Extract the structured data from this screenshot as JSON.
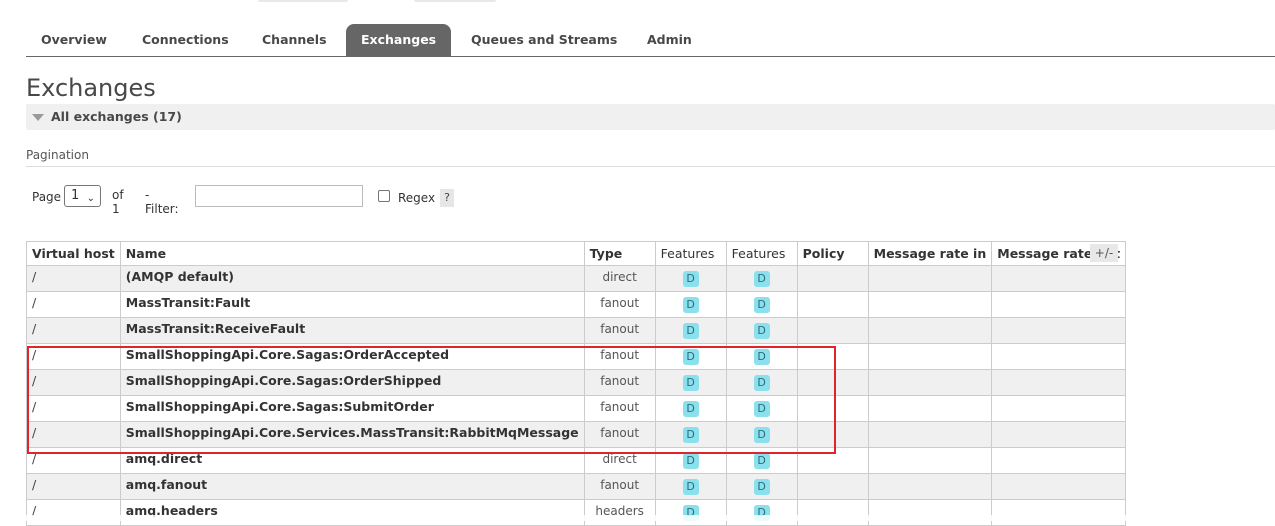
{
  "nav": {
    "tabs": [
      {
        "label": "Overview"
      },
      {
        "label": "Connections"
      },
      {
        "label": "Channels"
      },
      {
        "label": "Exchanges",
        "active": true
      },
      {
        "label": "Queues and Streams"
      },
      {
        "label": "Admin"
      }
    ]
  },
  "page": {
    "title": "Exchanges",
    "section_header": "All exchanges (17)"
  },
  "pagination": {
    "title": "Pagination",
    "page_label": "Page",
    "page_value": "1",
    "of_label": "of 1",
    "filter_label": "- Filter:",
    "filter_value": "",
    "regex_label": "Regex",
    "regex_checked": false,
    "help_label": "?"
  },
  "table": {
    "columns": [
      "Virtual host",
      "Name",
      "Type",
      "Features",
      "Features",
      "Policy",
      "Message rate in",
      "Message rate out"
    ],
    "columns_toggle": "+/-",
    "feature_badge": "D",
    "rows": [
      {
        "vhost": "/",
        "name": "(AMQP default)",
        "type": "direct"
      },
      {
        "vhost": "/",
        "name": "MassTransit:Fault",
        "type": "fanout"
      },
      {
        "vhost": "/",
        "name": "MassTransit:ReceiveFault",
        "type": "fanout"
      },
      {
        "vhost": "/",
        "name": "SmallShoppingApi.Core.Sagas:OrderAccepted",
        "type": "fanout"
      },
      {
        "vhost": "/",
        "name": "SmallShoppingApi.Core.Sagas:OrderShipped",
        "type": "fanout"
      },
      {
        "vhost": "/",
        "name": "SmallShoppingApi.Core.Sagas:SubmitOrder",
        "type": "fanout"
      },
      {
        "vhost": "/",
        "name": "SmallShoppingApi.Core.Services.MassTransit:RabbitMqMessage",
        "type": "fanout"
      },
      {
        "vhost": "/",
        "name": "amq.direct",
        "type": "direct"
      },
      {
        "vhost": "/",
        "name": "amq.fanout",
        "type": "fanout"
      },
      {
        "vhost": "/",
        "name": "amq.headers",
        "type": "headers"
      }
    ]
  },
  "colors": {
    "active_tab": "#666666",
    "badge": "#8be0ee",
    "highlight": "#e0242b"
  }
}
